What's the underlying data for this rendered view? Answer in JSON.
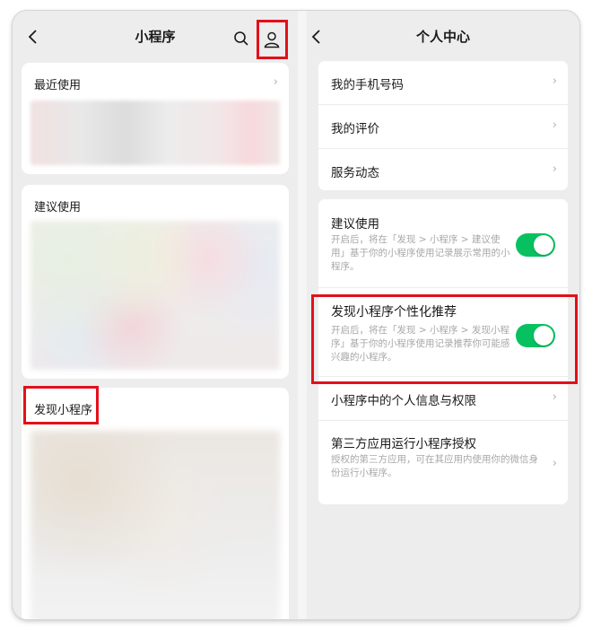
{
  "left": {
    "nav": {
      "title": "小程序"
    },
    "recent": {
      "label": "最近使用",
      "chevron": "›"
    },
    "suggested": {
      "label": "建议使用"
    },
    "discover": {
      "label": "发现小程序"
    }
  },
  "right": {
    "nav": {
      "title": "个人中心"
    },
    "group1": [
      {
        "label": "我的手机号码",
        "chevron": "›"
      },
      {
        "label": "我的评价",
        "chevron": "›"
      },
      {
        "label": "服务动态",
        "chevron": "›"
      }
    ],
    "group2": {
      "suggest": {
        "label": "建议使用",
        "desc": "开启后，将在「发现 > 小程序 > 建议使用」基于你的小程序使用记录展示常用的小程序。",
        "toggle": true
      },
      "personalized": {
        "label": "发现小程序个性化推荐",
        "desc": "开启后，将在「发现 > 小程序 > 发现小程序」基于你的小程序使用记录推荐你可能感兴趣的小程序。",
        "toggle": true
      },
      "privacy": {
        "label": "小程序中的个人信息与权限",
        "chevron": "›"
      },
      "third_party": {
        "label": "第三方应用运行小程序授权",
        "desc": "授权的第三方应用，可在其应用内使用你的微信身份运行小程序。",
        "chevron": "›"
      }
    }
  },
  "colors": {
    "accent_green": "#07c160",
    "highlight_red": "#e3101a"
  },
  "icons": [
    "back-arrow-icon",
    "search-icon",
    "user-icon",
    "chevron-right-icon"
  ]
}
